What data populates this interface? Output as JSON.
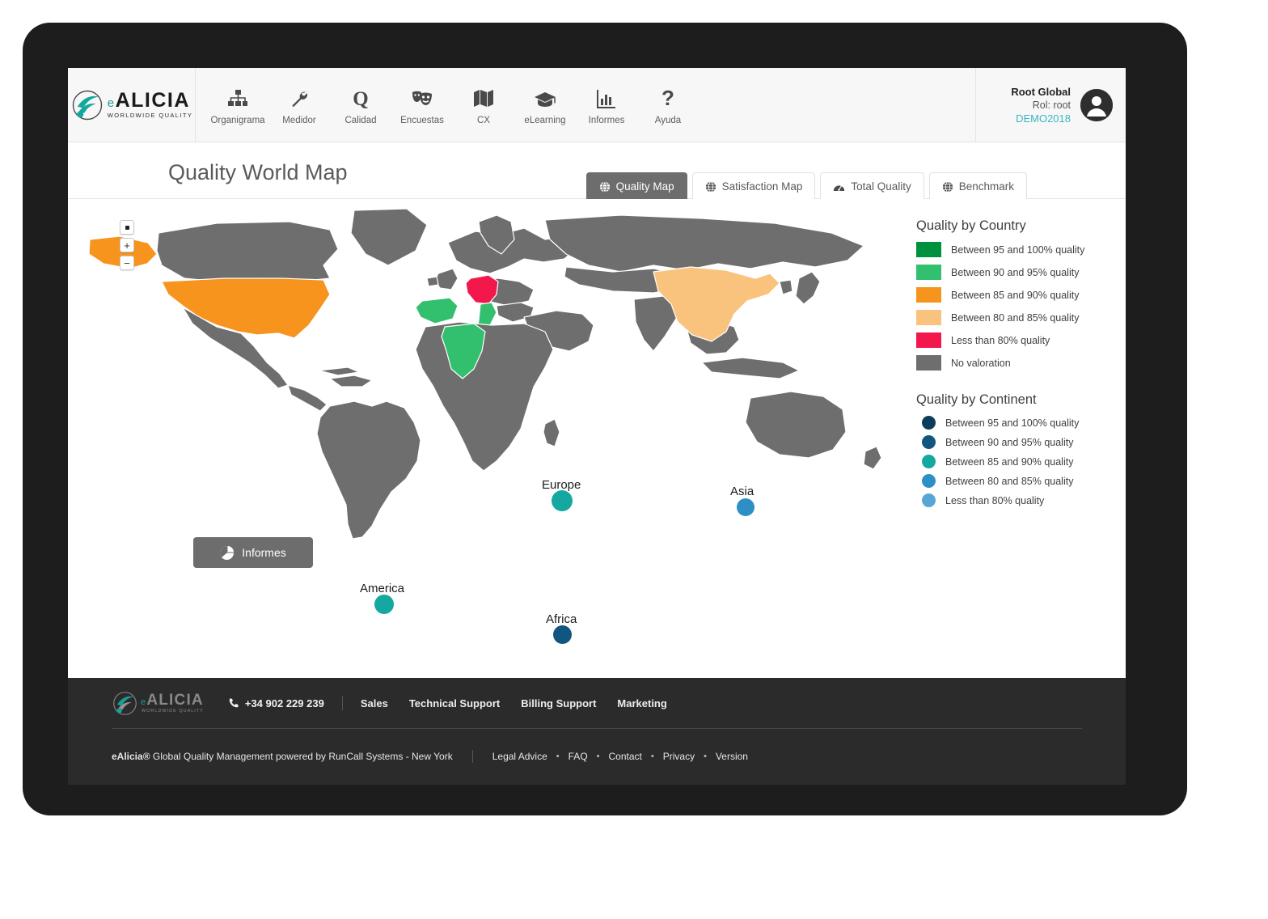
{
  "brand": {
    "word_e": "e",
    "word": "ALICIA",
    "tagline": "WORLDWIDE QUALITY"
  },
  "nav": {
    "items": [
      {
        "label": "Organigrama",
        "icon": "sitemap-icon"
      },
      {
        "label": "Medidor",
        "icon": "wrench-icon"
      },
      {
        "label": "Calidad",
        "icon": "letter-q-icon"
      },
      {
        "label": "Encuestas",
        "icon": "theater-masks-icon"
      },
      {
        "label": "CX",
        "icon": "map-folded-icon"
      },
      {
        "label": "eLearning",
        "icon": "graduation-cap-icon"
      },
      {
        "label": "Informes",
        "icon": "bar-chart-icon"
      },
      {
        "label": "Ayuda",
        "icon": "question-mark-icon"
      }
    ]
  },
  "user": {
    "name": "Root Global",
    "role": "Rol: root",
    "account": "DEMO2018",
    "avatar_icon": "user-circle-icon"
  },
  "page": {
    "title": "Quality World Map"
  },
  "tabs": [
    {
      "label": "Quality Map",
      "icon": "globe-icon",
      "active": true
    },
    {
      "label": "Satisfaction Map",
      "icon": "globe-icon",
      "active": false
    },
    {
      "label": "Total Quality",
      "icon": "gauge-icon",
      "active": false
    },
    {
      "label": "Benchmark",
      "icon": "globe-icon",
      "active": false
    }
  ],
  "map_controls": [
    {
      "name": "reset-zoom",
      "glyph": "dot"
    },
    {
      "name": "zoom-in",
      "glyph": "+"
    },
    {
      "name": "zoom-out",
      "glyph": "−"
    }
  ],
  "chart_data": {
    "type": "map",
    "title": "Quality World Map",
    "country_values": [
      {
        "country": "United States",
        "band": "Between 85 and 90% quality",
        "color": "#f7941e"
      },
      {
        "country": "Alaska",
        "band": "Between 85 and 90% quality",
        "color": "#f7941e"
      },
      {
        "country": "China",
        "band": "Between 80 and 85% quality",
        "color": "#fac37d"
      },
      {
        "country": "Germany",
        "band": "Less than 80% quality",
        "color": "#f2184c"
      },
      {
        "country": "Spain",
        "band": "Between 90 and 95% quality",
        "color": "#33c06e"
      },
      {
        "country": "Italy",
        "band": "Between 90 and 95% quality",
        "color": "#33c06e"
      },
      {
        "country": "Algeria",
        "band": "Between 90 and 95% quality",
        "color": "#33c06e"
      },
      {
        "country": "All others",
        "band": "No valoration",
        "color": "#6e6e6e"
      }
    ],
    "continent_values": [
      {
        "continent": "America",
        "band": "Between 85 and 90% quality",
        "color": "#14a8a0"
      },
      {
        "continent": "Europe",
        "band": "Between 85 and 90% quality",
        "color": "#14a8a0"
      },
      {
        "continent": "Africa",
        "band": "Between 90 and 95% quality",
        "color": "#10567f"
      },
      {
        "continent": "Asia",
        "band": "Between 80 and 85% quality",
        "color": "#2e8fc6"
      }
    ]
  },
  "markers": [
    {
      "label": "America",
      "color": "#14a8a0"
    },
    {
      "label": "Europe",
      "color": "#14a8a0"
    },
    {
      "label": "Africa",
      "color": "#10567f"
    },
    {
      "label": "Asia",
      "color": "#2e8fc6"
    }
  ],
  "informes_button": {
    "label": "Informes",
    "icon": "pie-chart-icon"
  },
  "legend_country": {
    "title": "Quality by Country",
    "items": [
      {
        "label": "Between 95 and 100% quality",
        "color": "#00913f"
      },
      {
        "label": "Between 90 and 95% quality",
        "color": "#33c06e"
      },
      {
        "label": "Between 85 and 90% quality",
        "color": "#f7941e"
      },
      {
        "label": "Between 80 and 85% quality",
        "color": "#fac37d"
      },
      {
        "label": "Less than 80% quality",
        "color": "#f2184c"
      },
      {
        "label": "No valoration",
        "color": "#6e6e6e"
      }
    ]
  },
  "legend_continent": {
    "title": "Quality by Continent",
    "items": [
      {
        "label": "Between 95 and 100% quality",
        "color": "#0d3c5c"
      },
      {
        "label": "Between 90 and 95% quality",
        "color": "#10567f"
      },
      {
        "label": "Between 85 and 90% quality",
        "color": "#14a8a0"
      },
      {
        "label": "Between 80 and 85% quality",
        "color": "#2e8fc6"
      },
      {
        "label": "Less than 80% quality",
        "color": "#57a6d6"
      }
    ]
  },
  "footer": {
    "phone": "+34 902 229 239",
    "phone_icon": "phone-icon",
    "links": [
      "Sales",
      "Technical Support",
      "Billing Support",
      "Marketing"
    ],
    "copyright_brand": "eAlicia®",
    "copyright_text": "Global Quality Management powered by RunCall Systems - New York",
    "bottom_links": [
      "Legal Advice",
      "FAQ",
      "Contact",
      "Privacy",
      "Version"
    ],
    "separator": "•"
  }
}
